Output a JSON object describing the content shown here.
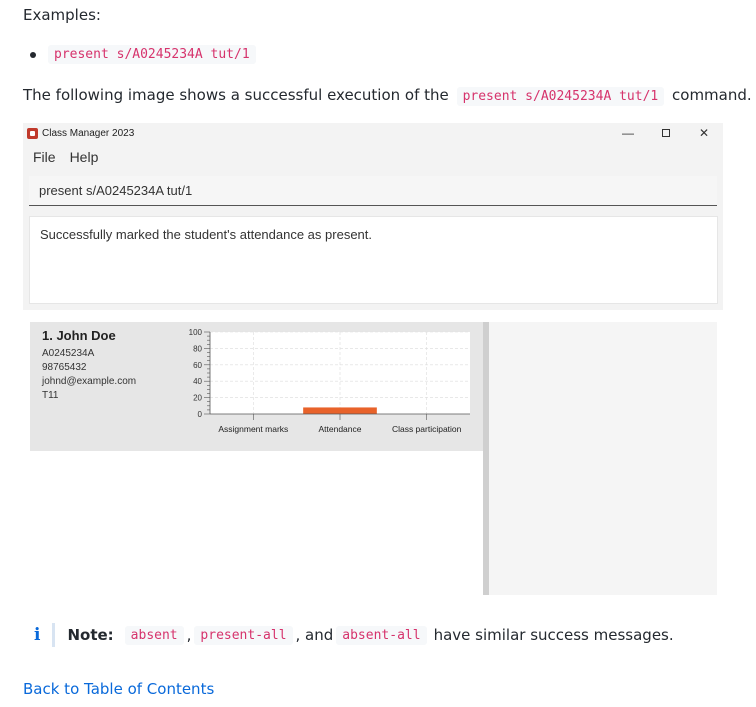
{
  "doc": {
    "examples_label": "Examples:",
    "example_command": "present s/A0245234A tut/1",
    "sentence_before": "The following image shows a successful execution of the",
    "sentence_code": "present s/A0245234A tut/1",
    "sentence_after": "command.",
    "note_icon": "i",
    "note_label": "Note:",
    "note_code_1": "absent",
    "note_sep_1": ",",
    "note_code_2": "present-all",
    "note_sep_2": ", and",
    "note_code_3": "absent-all",
    "note_after": "have similar success messages.",
    "back_link": "Back to Table of Contents"
  },
  "app": {
    "title": "Class Manager 2023",
    "menu": [
      "File",
      "Help"
    ],
    "command_text": "present s/A0245234A tut/1",
    "result_text": "Successfully marked the student's attendance as present.",
    "student": {
      "index_name": "1.  John Doe",
      "student_number": "A0245234A",
      "phone": "98765432",
      "email": "johnd@example.com",
      "class": "T11"
    }
  },
  "colors": {
    "accent": "#e8622a",
    "link": "#0969da",
    "code": "#d6336c"
  },
  "chart_data": {
    "type": "bar",
    "categories": [
      "Assignment marks",
      "Attendance",
      "Class participation"
    ],
    "values": [
      0,
      8,
      0
    ],
    "ylim": [
      0,
      100
    ],
    "yticks": [
      0,
      20,
      40,
      60,
      80,
      100
    ],
    "grid": true
  }
}
